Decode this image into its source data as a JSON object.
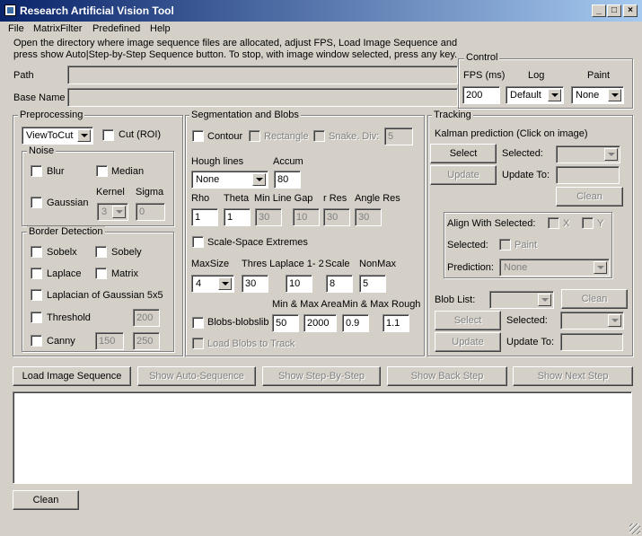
{
  "window": {
    "title": "Research Artificial Vision Tool",
    "caption_min": "_",
    "caption_max": "□",
    "caption_close": "×"
  },
  "menu": [
    "File",
    "MatrixFilter",
    "Predefined",
    "Help"
  ],
  "instructions": [
    "Open the directory where image sequence files are allocated, adjust FPS, Load Image Sequence and",
    "press show Auto|Step-by-Step Sequence button. To stop, with image window selected, press any key."
  ],
  "path_label": "Path",
  "basename_label": "Base Name",
  "control": {
    "title": "Control",
    "fps_label": "FPS (ms)",
    "log_label": "Log",
    "paint_label": "Paint",
    "fps_value": "200",
    "log_value": "Default",
    "paint_value": "None"
  },
  "preprocessing": {
    "title": "Preprocessing",
    "cut_mode": "ViewToCut",
    "cut_label": "Cut (ROI)",
    "noise": {
      "title": "Noise",
      "blur": "Blur",
      "median": "Median",
      "gaussian": "Gaussian",
      "kernel_label": "Kernel",
      "sigma_label": "Sigma",
      "kernel_value": "3",
      "sigma_value": "0"
    },
    "border": {
      "title": "Border Detection",
      "sobelx": "Sobelx",
      "sobely": "Sobely",
      "laplace": "Laplace",
      "matrix": "Matrix",
      "log": "Laplacian of Gaussian 5x5",
      "threshold": "Threshold",
      "threshold_value": "200",
      "canny": "Canny",
      "canny_low": "150",
      "canny_high": "250"
    }
  },
  "segmentation": {
    "title": "Segmentation and Blobs",
    "contour": "Contour",
    "rectangle": "Rectangle",
    "snake": "Snake. Div:",
    "snake_value": "5",
    "hough_label": "Hough lines",
    "hough_value": "None",
    "accum_label": "Accum",
    "accum_value": "80",
    "rho_label": "Rho",
    "theta_label": "Theta",
    "minline_label": "Min Line Gap",
    "rres_label": "r Res",
    "angleres_label": "Angle Res",
    "rho_value": "1",
    "theta_value": "1",
    "minline_value": "30",
    "gap_value": "10",
    "rres_value": "30",
    "angleres_value": "30",
    "scalespace": "Scale-Space Extremes",
    "maxsize_label": "MaxSize",
    "thres_label": "Thres Laplace 1- 2",
    "scale_label": "Scale",
    "nonmax_label": "NonMax",
    "maxsize_value": "4",
    "thres1_value": "30",
    "thres2_value": "10",
    "scale_value": "8",
    "nonmax_value": "5",
    "minmax_area_label": "Min & Max Area",
    "minmax_rough_label": "Min & Max Rough",
    "blobs_label": "Blobs-blobslib",
    "area_min": "50",
    "area_max": "2000",
    "rough_min": "0.9",
    "rough_max": "1.1",
    "load_blobs": "Load Blobs to Track"
  },
  "tracking": {
    "title": "Tracking",
    "kalman": "Kalman prediction (Click on image)",
    "select": "Select",
    "selected_label": "Selected:",
    "update": "Update",
    "update_to_label": "Update To:",
    "clean": "Clean",
    "align_label": "Align With Selected:",
    "x_label": "X",
    "y_label": "Y",
    "align_selected_label": "Selected:",
    "paint_label": "Paint",
    "prediction_label": "Prediction:",
    "prediction_value": "None",
    "bloblist_label": "Blob List:",
    "clean2": "Clean",
    "select2": "Select",
    "selected2_label": "Selected:",
    "update2": "Update",
    "update_to2_label": "Update To:"
  },
  "actions": {
    "load": "Load Image Sequence",
    "auto": "Show Auto-Sequence",
    "step": "Show Step-By-Step",
    "back": "Show Back Step",
    "next": "Show Next Step"
  },
  "footer": {
    "clean": "Clean"
  }
}
